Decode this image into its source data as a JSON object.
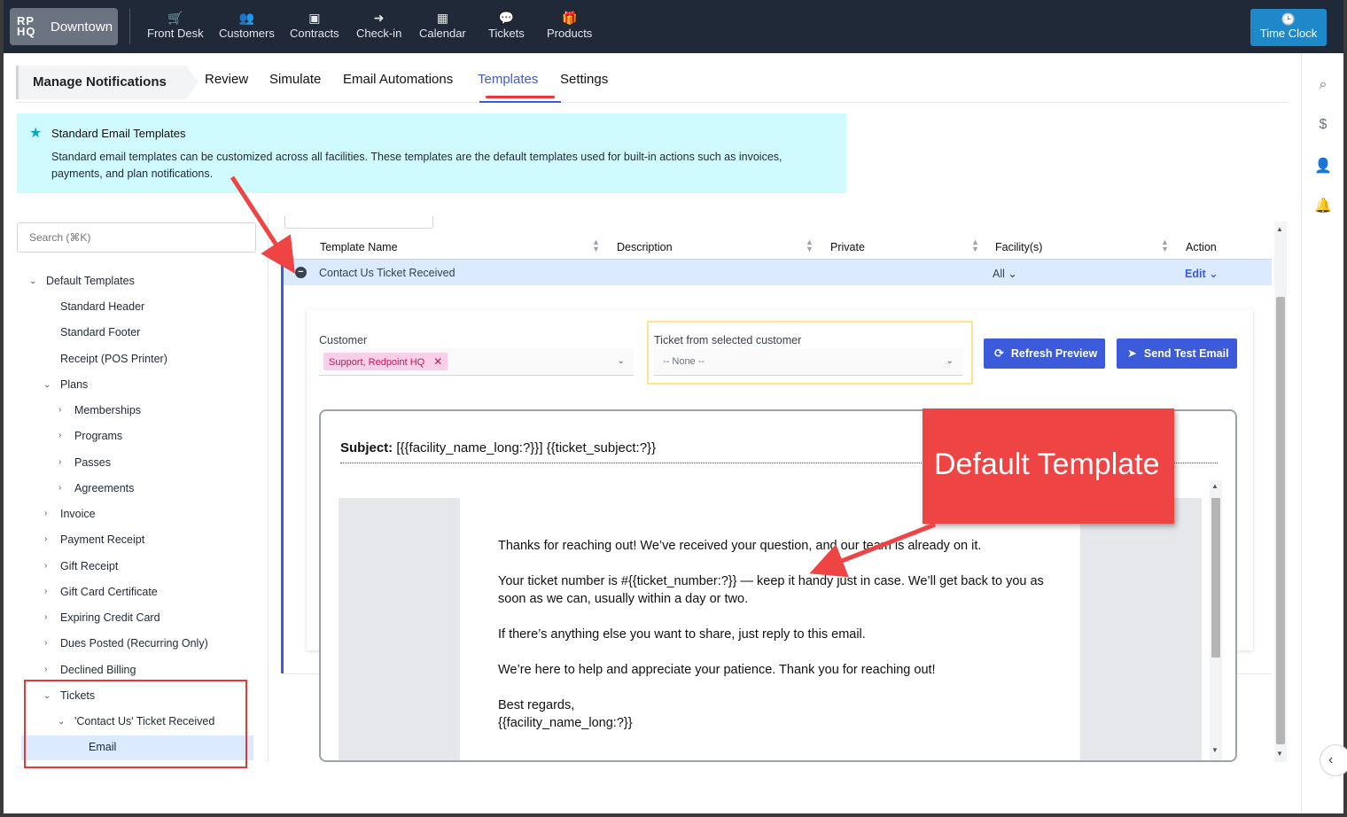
{
  "nav": {
    "brand_logo": "RP HQ",
    "brand_name": "Downtown",
    "items": [
      {
        "label": "Front Desk",
        "icon": "cart-icon"
      },
      {
        "label": "Customers",
        "icon": "users-icon"
      },
      {
        "label": "Contracts",
        "icon": "contracts-icon"
      },
      {
        "label": "Check-in",
        "icon": "check-in-icon"
      },
      {
        "label": "Calendar",
        "icon": "calendar-icon"
      },
      {
        "label": "Tickets",
        "icon": "chat-icon"
      },
      {
        "label": "Products",
        "icon": "products-icon"
      }
    ],
    "time_clock": "Time Clock"
  },
  "tabs": {
    "title": "Manage Notifications",
    "items": [
      "Review",
      "Simulate",
      "Email Automations",
      "Templates",
      "Settings"
    ],
    "active": "Templates"
  },
  "banner": {
    "title": "Standard Email Templates",
    "text": "Standard email templates can be customized across all facilities. These templates are the default templates used for built-in actions such as invoices, payments, and plan notifications."
  },
  "sidebar": {
    "search_placeholder": "Search (⌘K)",
    "tree": [
      "Default Templates",
      "Standard Header",
      "Standard Footer",
      "Receipt (POS Printer)",
      "Plans",
      "Memberships",
      "Programs",
      "Passes",
      "Agreements",
      "Invoice",
      "Payment Receipt",
      "Gift Receipt",
      "Gift Card Certificate",
      "Expiring Credit Card",
      "Dues Posted (Recurring Only)",
      "Declined Billing",
      "Tickets",
      "'Contact Us' Ticket Received",
      "Email"
    ]
  },
  "table": {
    "headers": [
      "Template Name",
      "Description",
      "Private",
      "Facility(s)",
      "Action"
    ],
    "row": {
      "name": "Contact Us Ticket Received",
      "facility": "All",
      "action": "Edit"
    }
  },
  "detail": {
    "customer_label": "Customer",
    "customer_value": "Support, Redpoint HQ",
    "ticket_label": "Ticket from selected customer",
    "ticket_value": "-- None --",
    "refresh_button": "Refresh Preview",
    "send_button": "Send Test Email"
  },
  "preview": {
    "subject_label": "Subject:",
    "subject_value": "[{{facility_name_long:?}}] {{ticket_subject:?}}",
    "paragraphs": [
      "Thanks for reaching out! We’ve received your question, and our team is already on it.",
      "Your ticket number is #{{ticket_number:?}} — keep it handy just in case. We’ll get back to you as soon as we can, usually within a day or two.",
      "If there’s anything else you want to share, just reply to this email.",
      "We’re here to help and appreciate your patience. Thank you for reaching out!"
    ],
    "signoff": "Best regards,",
    "signature": "{{facility_name_long:?}}"
  },
  "callout": {
    "text": "Default Template"
  },
  "colors": {
    "nav_bg": "#1f2937",
    "accent": "#3b5bdb",
    "time_clock": "#1e88c9",
    "banner": "#cffafe",
    "annotation": "#ef4444",
    "chip": "#fbcfe8"
  }
}
